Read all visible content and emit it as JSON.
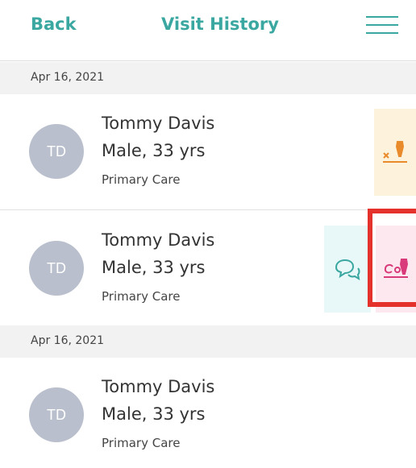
{
  "header": {
    "back_label": "Back",
    "title": "Visit History"
  },
  "sections": [
    {
      "date": "Apr 16, 2021"
    },
    {
      "date": "Apr 16, 2021"
    }
  ],
  "visits": [
    {
      "initials": "TD",
      "name": "Tommy Davis",
      "demographics": "Male, 33 yrs",
      "department": "Primary Care"
    },
    {
      "initials": "TD",
      "name": "Tommy Davis",
      "demographics": "Male, 33 yrs",
      "department": "Primary Care"
    },
    {
      "initials": "TD",
      "name": "Tommy Davis",
      "demographics": "Male, 33 yrs",
      "department": "Primary Care"
    }
  ],
  "colors": {
    "accent": "#3aa7a0",
    "orange": "#e98a2b",
    "pink": "#d93a7a",
    "highlight": "#e4312b"
  },
  "icons": {
    "cancel_sign": "cancel-sign-icon",
    "chat": "chat-icon",
    "cosign": "cosign-icon"
  }
}
